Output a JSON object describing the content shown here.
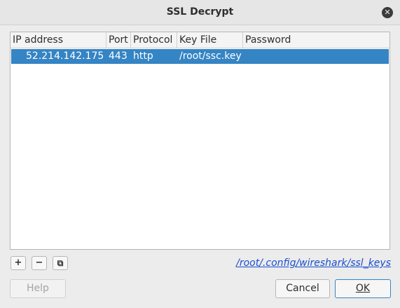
{
  "window": {
    "title": "SSL Decrypt",
    "close_symbol": "✕"
  },
  "table": {
    "columns": [
      "IP address",
      "Port",
      "Protocol",
      "Key File",
      "Password"
    ],
    "rows": [
      {
        "ip": "52.214.142.175",
        "port": "443",
        "protocol": "http",
        "key_file": "/root/ssc.key",
        "password": ""
      }
    ],
    "selected_color": "#3584c4"
  },
  "toolbar": {
    "add_symbol": "+",
    "remove_symbol": "−",
    "copy_symbol": "⧉",
    "keys_path": "/root/.config/wireshark/ssl_keys"
  },
  "buttons": {
    "help_label": "Help",
    "cancel_label": "Cancel",
    "ok_label": "OK"
  }
}
